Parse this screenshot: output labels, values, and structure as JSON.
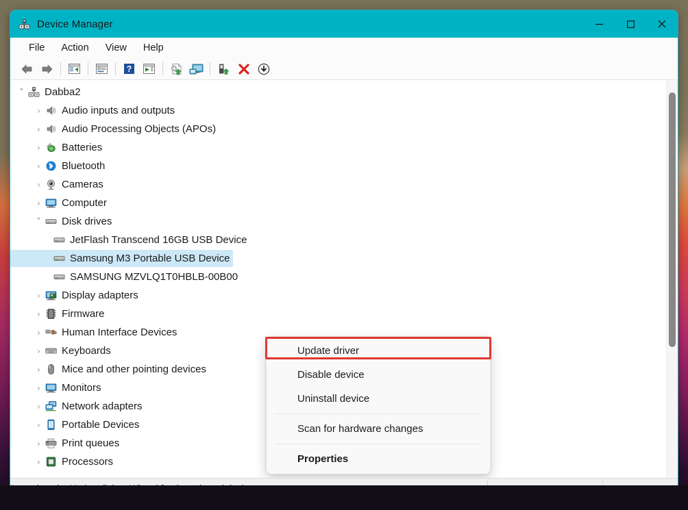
{
  "window": {
    "title": "Device Manager",
    "app_icon": "device-manager-icon",
    "titlebar_color": "#00b3c4",
    "controls": [
      {
        "name": "minimize",
        "glyph": "minimize-icon"
      },
      {
        "name": "maximize",
        "glyph": "maximize-icon"
      },
      {
        "name": "close",
        "glyph": "close-icon"
      }
    ]
  },
  "menubar": {
    "items": [
      {
        "label": "File"
      },
      {
        "label": "Action"
      },
      {
        "label": "View"
      },
      {
        "label": "Help"
      }
    ]
  },
  "toolbar": {
    "buttons": [
      {
        "name": "back-icon",
        "tip": "Back"
      },
      {
        "name": "forward-icon",
        "tip": "Forward"
      },
      {
        "sep": true
      },
      {
        "name": "show-hide-console-tree-icon",
        "tip": "Show/Hide Console Tree"
      },
      {
        "sep": true
      },
      {
        "name": "properties-icon",
        "tip": "Properties"
      },
      {
        "sep": true
      },
      {
        "name": "help-icon",
        "tip": "Help"
      },
      {
        "name": "update-driver-icon",
        "tip": "Update driver"
      },
      {
        "sep": true
      },
      {
        "name": "scan-for-hardware-changes-icon",
        "tip": "Scan for hardware changes"
      },
      {
        "name": "show-all-devices-icon",
        "tip": "Show all devices"
      },
      {
        "sep": true
      },
      {
        "name": "enable-device-icon",
        "tip": "Enable device"
      },
      {
        "name": "uninstall-device-icon",
        "tip": "Uninstall device"
      },
      {
        "name": "disable-device-icon",
        "tip": "Disable device"
      }
    ]
  },
  "tree": {
    "nodes": [
      {
        "label": "Dabba2",
        "level": 0,
        "state": "expanded",
        "icon": "computer-root-icon",
        "selected": false
      },
      {
        "label": "Audio inputs and outputs",
        "level": 1,
        "state": "collapsed",
        "icon": "speaker-icon",
        "selected": false
      },
      {
        "label": "Audio Processing Objects (APOs)",
        "level": 1,
        "state": "collapsed",
        "icon": "speaker-icon",
        "selected": false
      },
      {
        "label": "Batteries",
        "level": 1,
        "state": "collapsed",
        "icon": "battery-icon",
        "selected": false
      },
      {
        "label": "Bluetooth",
        "level": 1,
        "state": "collapsed",
        "icon": "bluetooth-icon",
        "selected": false
      },
      {
        "label": "Cameras",
        "level": 1,
        "state": "collapsed",
        "icon": "camera-icon",
        "selected": false
      },
      {
        "label": "Computer",
        "level": 1,
        "state": "collapsed",
        "icon": "monitor-icon",
        "selected": false
      },
      {
        "label": "Disk drives",
        "level": 1,
        "state": "expanded",
        "icon": "disk-drive-icon",
        "selected": false
      },
      {
        "label": "JetFlash Transcend 16GB USB Device",
        "level": 2,
        "state": "leaf",
        "icon": "disk-drive-icon",
        "selected": false
      },
      {
        "label": "Samsung M3 Portable USB Device",
        "level": 2,
        "state": "leaf",
        "icon": "disk-drive-icon",
        "selected": true
      },
      {
        "label": "SAMSUNG MZVLQ1T0HBLB-00B00",
        "level": 2,
        "state": "leaf",
        "icon": "disk-drive-icon",
        "selected": false
      },
      {
        "label": "Display adapters",
        "level": 1,
        "state": "collapsed",
        "icon": "display-adapter-icon",
        "selected": false
      },
      {
        "label": "Firmware",
        "level": 1,
        "state": "collapsed",
        "icon": "firmware-chip-icon",
        "selected": false
      },
      {
        "label": "Human Interface Devices",
        "level": 1,
        "state": "collapsed",
        "icon": "hid-icon",
        "selected": false
      },
      {
        "label": "Keyboards",
        "level": 1,
        "state": "collapsed",
        "icon": "keyboard-icon",
        "selected": false
      },
      {
        "label": "Mice and other pointing devices",
        "level": 1,
        "state": "collapsed",
        "icon": "mouse-icon",
        "selected": false
      },
      {
        "label": "Monitors",
        "level": 1,
        "state": "collapsed",
        "icon": "monitor-icon",
        "selected": false
      },
      {
        "label": "Network adapters",
        "level": 1,
        "state": "collapsed",
        "icon": "network-adapter-icon",
        "selected": false
      },
      {
        "label": "Portable Devices",
        "level": 1,
        "state": "collapsed",
        "icon": "portable-device-icon",
        "selected": false
      },
      {
        "label": "Print queues",
        "level": 1,
        "state": "collapsed",
        "icon": "printer-icon",
        "selected": false
      },
      {
        "label": "Processors",
        "level": 1,
        "state": "collapsed",
        "icon": "processor-icon",
        "selected": false
      }
    ],
    "selection_highlight_color": "#cde8f7",
    "chevron_collapsed": "›",
    "chevron_expanded": "ˇ"
  },
  "context_menu": {
    "items": [
      {
        "label": "Update driver",
        "bold": false,
        "highlighted": true
      },
      {
        "label": "Disable device",
        "bold": false,
        "highlighted": false
      },
      {
        "label": "Uninstall device",
        "bold": false,
        "highlighted": false
      },
      {
        "separator": true
      },
      {
        "label": "Scan for hardware changes",
        "bold": false,
        "highlighted": false
      },
      {
        "separator": true
      },
      {
        "label": "Properties",
        "bold": true,
        "highlighted": false
      }
    ],
    "highlight_color": "#e0382f"
  },
  "statusbar": {
    "text": "Launches the Update Driver Wizard for the selected device."
  }
}
